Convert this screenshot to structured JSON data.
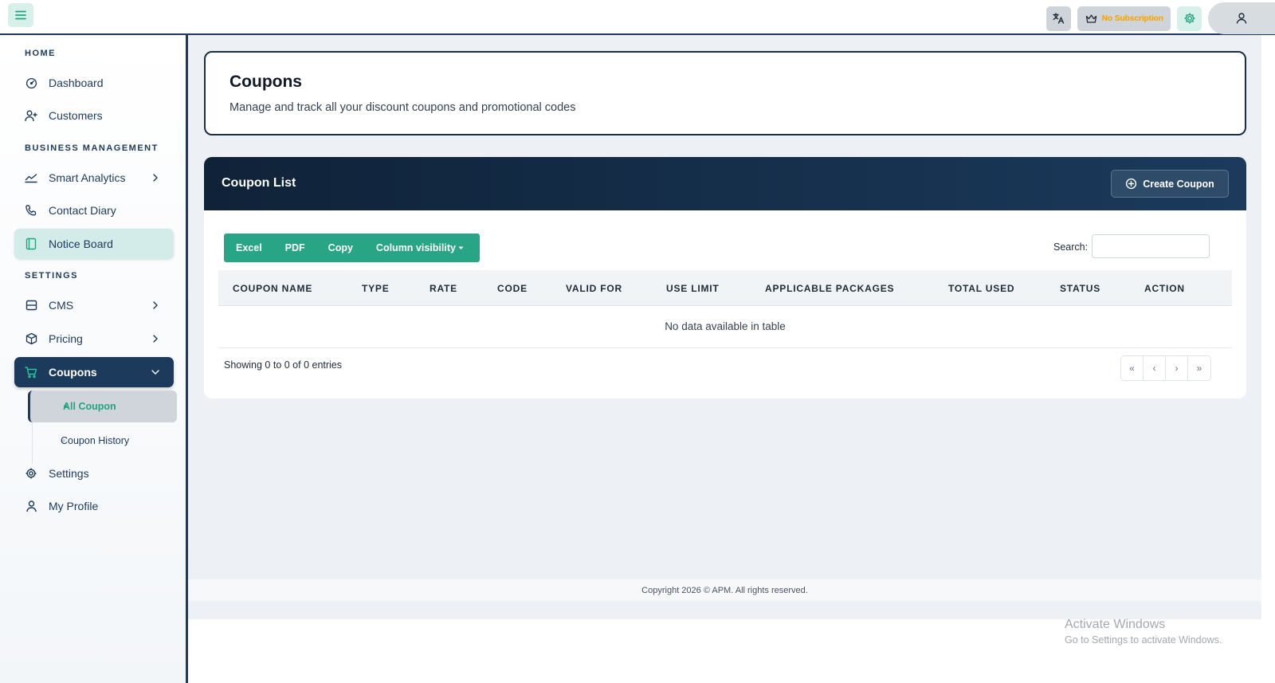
{
  "topbar": {
    "subscription_label": "No Subscription"
  },
  "sidebar": {
    "sections": {
      "home": "HOME",
      "business": "BUSINESS MANAGEMENT",
      "settings": "SETTINGS"
    },
    "items": {
      "dashboard": "Dashboard",
      "customers": "Customers",
      "smart_analytics": "Smart Analytics",
      "contact_diary": "Contact Diary",
      "notice_board": "Notice Board",
      "cms": "CMS",
      "pricing": "Pricing",
      "coupons": "Coupons",
      "all_coupon": "All Coupon",
      "coupon_history": "Coupon History",
      "settings": "Settings",
      "my_profile": "My Profile"
    }
  },
  "header": {
    "title": "Coupons",
    "subtitle": "Manage and track all your discount coupons and promotional codes"
  },
  "coupon_list": {
    "title": "Coupon List",
    "create_label": "Create Coupon",
    "export_buttons": [
      "Excel",
      "PDF",
      "Copy",
      "Column visibility"
    ],
    "search_label": "Search:",
    "search_value": "",
    "columns": [
      "COUPON NAME",
      "TYPE",
      "RATE",
      "CODE",
      "VALID FOR",
      "USE LIMIT",
      "APPLICABLE PACKAGES",
      "TOTAL USED",
      "STATUS",
      "ACTION"
    ],
    "empty_text": "No data available in table",
    "info_text": "Showing 0 to 0 of 0 entries",
    "pager": [
      "«",
      "‹",
      "›",
      "»"
    ]
  },
  "footer": {
    "copyright": "Copyright 2026 © APM. All rights reserved."
  },
  "watermark": {
    "line1": "Activate Windows",
    "line2": "Go to Settings to activate Windows."
  },
  "colors": {
    "primary_dark": "#1b3a5c",
    "accent_green": "#27a585",
    "subscription_orange": "#f2a100"
  }
}
